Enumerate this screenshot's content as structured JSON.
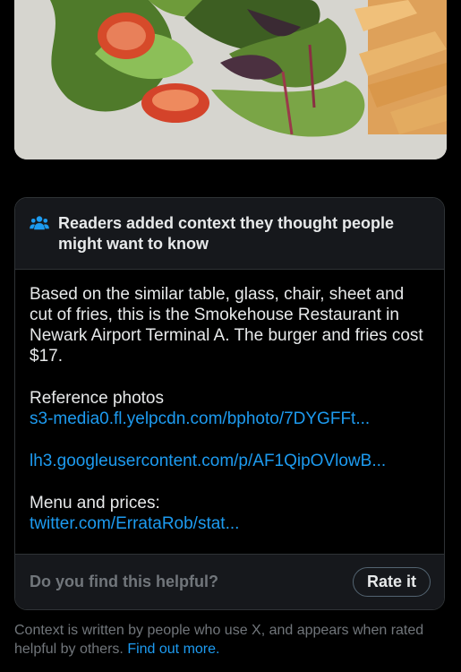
{
  "note": {
    "title": "Readers added context they thought people might want to know",
    "text": "Based on the similar table, glass, chair, sheet and cut of fries, this is the Smokehouse Restaurant in Newark Airport Terminal A. The burger and fries cost $17.",
    "ref_label": "Reference photos",
    "links": [
      "s3-media0.fl.yelpcdn.com/bphoto/7DYGFFt...",
      "lh3.googleusercontent.com/p/AF1QipOVlowB..."
    ],
    "menu_label": "Menu and prices:",
    "menu_link": "twitter.com/ErrataRob/stat...",
    "footer_question": "Do you find this helpful?",
    "rate_button": "Rate it"
  },
  "disclaimer": {
    "text": "Context is written by people who use X, and appears when rated helpful by others.",
    "link": "Find out more."
  },
  "icons": {
    "note_icon": "people-icon"
  },
  "colors": {
    "background": "#000000",
    "link": "#1d9bf0",
    "muted": "#71767b",
    "panel": "#16181c"
  }
}
